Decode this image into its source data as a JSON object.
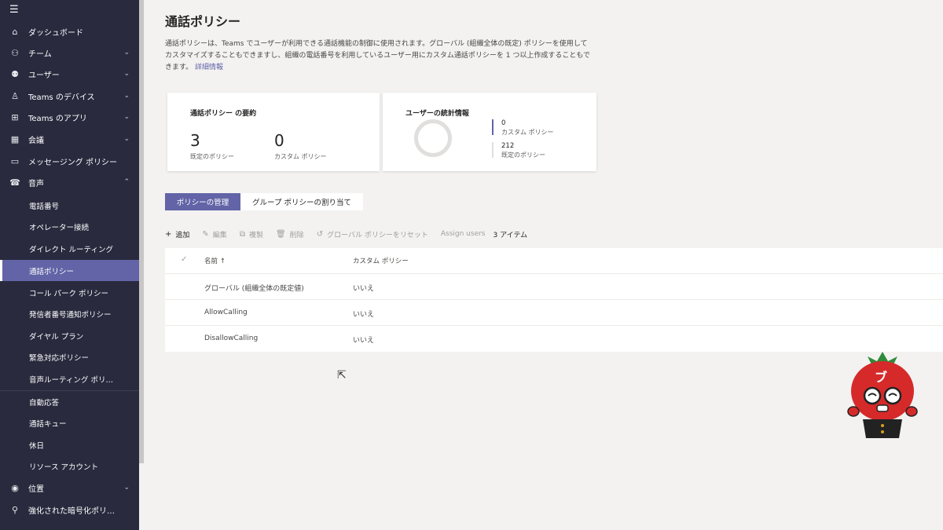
{
  "sidebar": {
    "items": [
      {
        "icon": "home-icon",
        "label": "ダッシュボード"
      },
      {
        "icon": "team-icon",
        "label": "チーム"
      },
      {
        "icon": "users-icon",
        "label": "ユーザー"
      },
      {
        "icon": "device-icon",
        "label": "Teams のデバイス"
      },
      {
        "icon": "apps-icon",
        "label": "Teams のアプリ"
      },
      {
        "icon": "calendar-icon",
        "label": "会議"
      },
      {
        "icon": "message-icon",
        "label": "メッセージング ポリシー"
      },
      {
        "icon": "phone-icon",
        "label": "音声"
      }
    ],
    "voice_sub": [
      "電話番号",
      "オペレーター接続",
      "ダイレクト ルーティング",
      "通話ポリシー",
      "コール パーク ポリシー",
      "発信者番号通知ポリシー",
      "ダイヤル プラン",
      "緊急対応ポリシー",
      "音声ルーティング ポリ…",
      "自動応答",
      "通話キュー",
      "休日",
      "リソース アカウント"
    ],
    "bottom": [
      {
        "icon": "globe-icon",
        "label": "位置"
      },
      {
        "icon": "lock-icon",
        "label": "強化された暗号化ポリ…"
      }
    ]
  },
  "page": {
    "title": "通話ポリシー",
    "description": "通話ポリシーは、Teams でユーザーが利用できる通話機能の制御に使用されます。グローバル (組織全体の既定) ポリシーを使用してカスタマイズすることもできますし、組織の電話番号を利用しているユーザー用にカスタム通話ポリシーを 1 つ以上作成することもできます。",
    "link": "詳細情報"
  },
  "summary": {
    "title": "通話ポリシー の要約",
    "default_count": "3",
    "default_label": "既定のポリシー",
    "custom_count": "0",
    "custom_label": "カスタム ポリシー"
  },
  "stats": {
    "title": "ユーザーの統計情報",
    "custom_num": "0",
    "custom_label": "カスタム ポリシー",
    "default_num": "212",
    "default_label": "既定のポリシー",
    "custom_color": "#6264a7",
    "default_color": "#e1dfdd"
  },
  "tabs": [
    "ポリシーの管理",
    "グループ ポリシーの割り当て"
  ],
  "toolbar": {
    "add": "追加",
    "edit": "編集",
    "copy": "複製",
    "delete": "削除",
    "reset": "グローバル ポリシーをリセット",
    "assign": "Assign users",
    "count": "3 アイテム"
  },
  "table": {
    "headers": [
      "名前 ↑",
      "カスタム ポリシー"
    ],
    "rows": [
      {
        "name": "グローバル (組織全体の既定値)",
        "custom": "いいえ"
      },
      {
        "name": "AllowCalling",
        "custom": "いいえ"
      },
      {
        "name": "DisallowCalling",
        "custom": "いいえ"
      }
    ]
  },
  "colors": {
    "sidebar_bg": "#292a3e",
    "accent": "#6264a7"
  }
}
